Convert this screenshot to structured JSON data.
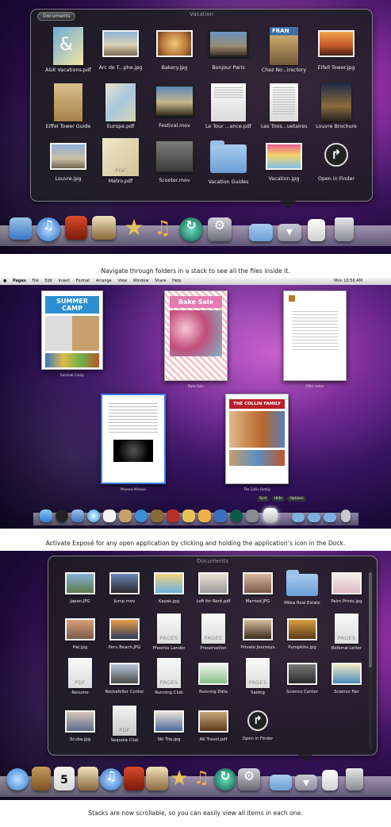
{
  "panel1": {
    "crumb": "Documents",
    "title": "Vacation",
    "items": [
      {
        "label": "A&K Vacations.pdf"
      },
      {
        "label": "Arc de T...phe.jpg"
      },
      {
        "label": "Bakery.jpg"
      },
      {
        "label": "Bonjour Paris"
      },
      {
        "label": "Chez No...irectory"
      },
      {
        "label": "Eifell Tower.jpg"
      },
      {
        "label": "Eiffel Tower Guide"
      },
      {
        "label": "Europe.pdf"
      },
      {
        "label": "Festival.mov"
      },
      {
        "label": "Le Tour ...ance.pdf"
      },
      {
        "label": "Les Trois...uetaires"
      },
      {
        "label": "Louvre Brochure"
      },
      {
        "label": "Louvre.jpg"
      },
      {
        "label": "Metro.pdf",
        "tag": "PDF"
      },
      {
        "label": "Scooter.mov"
      },
      {
        "label": "Vacation Guides"
      },
      {
        "label": "Vacation.jpg"
      },
      {
        "label": "Open in Finder"
      }
    ],
    "caption": "Navigate through folders in a stack to see all the files inside it."
  },
  "panel2": {
    "menu": [
      "Pages",
      "File",
      "Edit",
      "Insert",
      "Format",
      "Arrange",
      "View",
      "Window",
      "Share",
      "Help"
    ],
    "clock": "Mon 10:50 AM",
    "windows": [
      {
        "label": "Summer Camp",
        "heading": "SUMMER CAMP"
      },
      {
        "label": "Bake Sale",
        "heading": "Bake Sale"
      },
      {
        "label": "Offer Letter"
      },
      {
        "label": "Phoenix Mission"
      },
      {
        "label": "The Collin Family",
        "heading": "THE COLLIN FAMILY"
      }
    ],
    "controls": [
      "Sort",
      "Hide",
      "Options"
    ],
    "caption": "Activate Exposé for any open application by clicking and holding the application’s icon in the Dock."
  },
  "panel3": {
    "title": "Documents",
    "items": [
      {
        "label": "Japan.JPG"
      },
      {
        "label": "Jump.mov"
      },
      {
        "label": "Kayak.jpg"
      },
      {
        "label": "Loft for Rent.pdf"
      },
      {
        "label": "Married.JPG"
      },
      {
        "label": "Milea Real Estate"
      },
      {
        "label": "Palm Prints.jpg"
      },
      {
        "label": "Pat.jpg"
      },
      {
        "label": "Peru Beach.JPG"
      },
      {
        "label": "Phoenix Lander",
        "tag": "PAGES"
      },
      {
        "label": "Preservation",
        "tag": "PAGES"
      },
      {
        "label": "Private Journeys"
      },
      {
        "label": "Pumpkins.jpg"
      },
      {
        "label": "Referral Letter",
        "tag": "PAGES"
      },
      {
        "label": "Resume",
        "tag": "PDF"
      },
      {
        "label": "Rockafeller Center"
      },
      {
        "label": "Running Club",
        "tag": "PAGES"
      },
      {
        "label": "Running Data"
      },
      {
        "label": "Sailing",
        "tag": "PAGES"
      },
      {
        "label": "Science Center"
      },
      {
        "label": "Science Fair"
      },
      {
        "label": "Scuba.jpg"
      },
      {
        "label": "Sequoia Club",
        "tag": "PDF"
      },
      {
        "label": "Ski Trip.jpg"
      },
      {
        "label": "AK Travel.pdf"
      },
      {
        "label": "Open in Finder"
      }
    ],
    "caption": "Stacks are now scrollable, so you can easily view all items in each one."
  },
  "dock_calendar_day": "5",
  "colors": {
    "stack_bg": "#1e1e22",
    "folder": "#7fb0e2",
    "caption_text": "#222222"
  }
}
